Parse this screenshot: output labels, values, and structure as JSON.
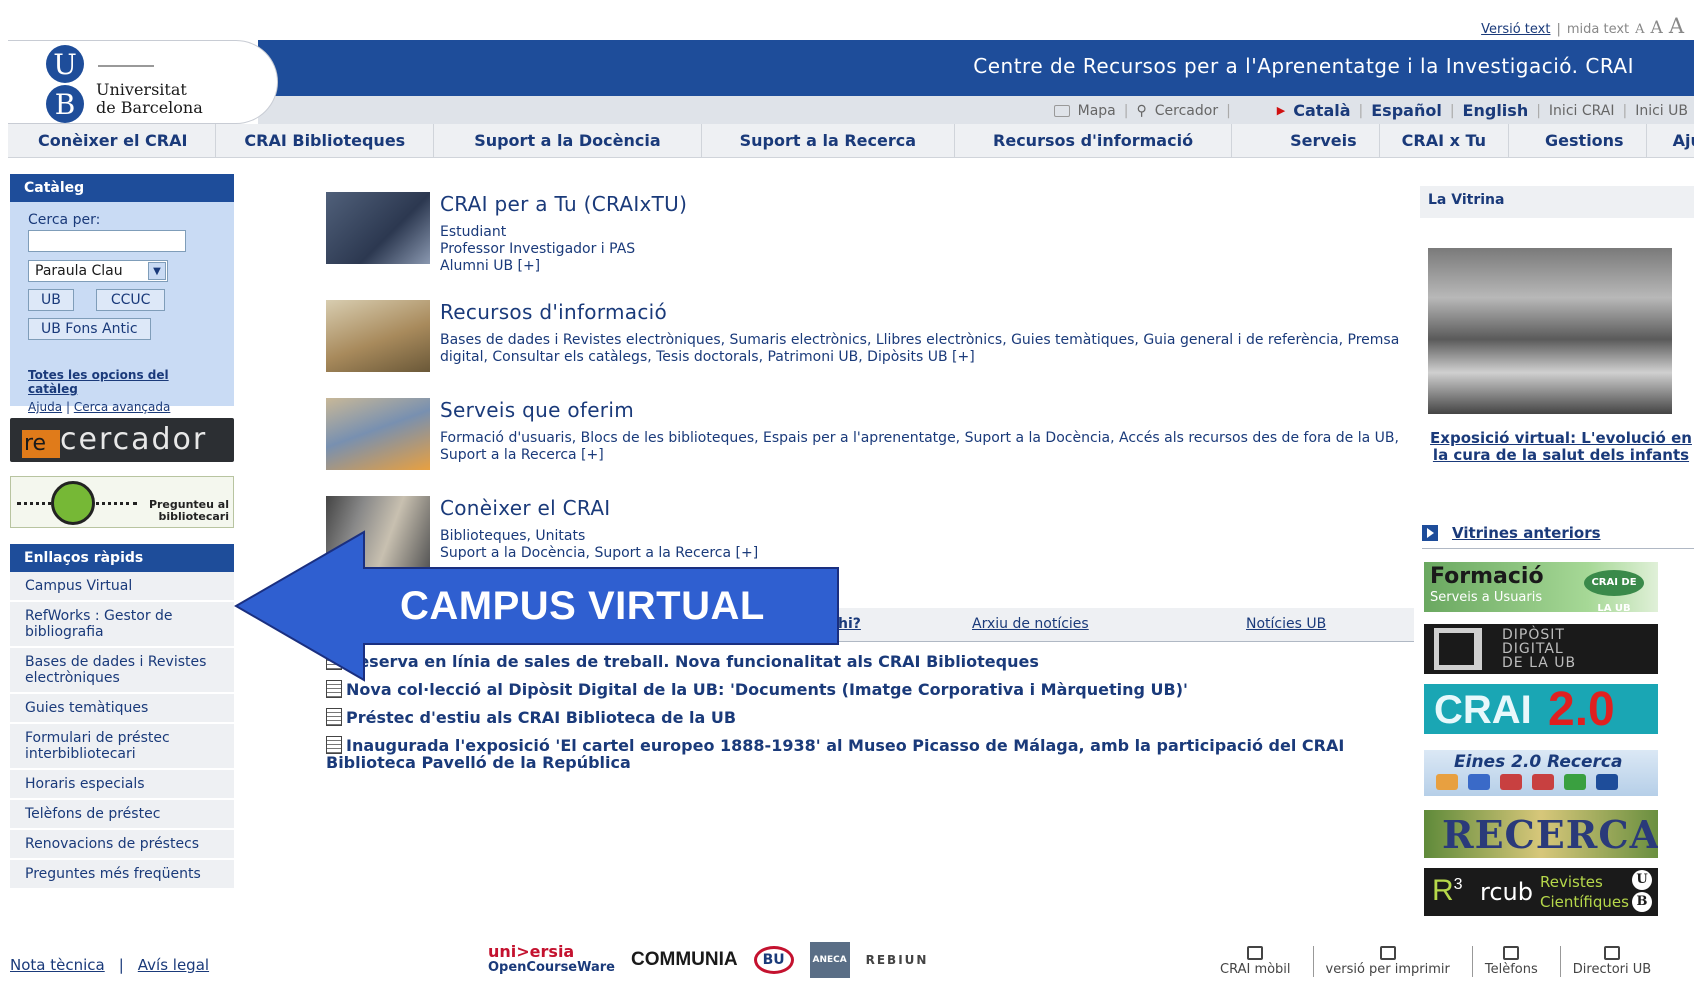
{
  "top_util": {
    "text_version": "Versió text",
    "text_size_label": "mida text",
    "sizes": [
      "A",
      "A",
      "A"
    ]
  },
  "header": {
    "logo_letters": [
      "U",
      "B"
    ],
    "logo_line1": "Universitat",
    "logo_line2": "de Barcelona",
    "title": "Centre de Recursos per a l'Aprenentatge i la Investigació. CRAI",
    "util": {
      "map": "Mapa",
      "search": "Cercador",
      "lang_ca": "Català",
      "lang_es": "Español",
      "lang_en": "English",
      "home_crai": "Inici CRAI",
      "home_ub": "Inici UB"
    }
  },
  "nav": [
    "Conèixer el CRAI",
    "CRAI Biblioteques",
    "Suport a la Docència",
    "Suport a la Recerca",
    "Recursos d'informació",
    "Serveis",
    "CRAI x Tu",
    "Gestions",
    "Ajuda"
  ],
  "catalog": {
    "title": "Catàleg",
    "search_label": "Cerca per:",
    "search_value": "",
    "select_value": "Paraula Clau",
    "btn_ub": "UB",
    "btn_ccuc": "CCUC",
    "btn_fons": "UB Fons Antic",
    "all_options": "Totes les opcions del catàleg",
    "help": "Ajuda",
    "advanced": "Cerca avançada"
  },
  "recercador": {
    "re": "re",
    "rest": "cercador"
  },
  "pregunteu": {
    "line1": "Pregunteu al",
    "line2": "bibliotecari"
  },
  "quick": {
    "title": "Enllaços ràpids",
    "items": [
      "Campus Virtual",
      "RefWorks : Gestor de bibliografia",
      "Bases de dades i Revistes electròniques",
      "Guies temàtiques",
      "Formulari de préstec interbibliotecari",
      "Horaris especials",
      "Telèfons de préstec",
      "Renovacions de préstecs",
      "Preguntes més freqüents"
    ]
  },
  "sections": [
    {
      "title": "CRAI per a Tu (CRAIxTU)",
      "lines": [
        "Estudiant",
        "Professor Investigador i PAS",
        "Alumni UB [+]"
      ]
    },
    {
      "title": "Recursos d'informació",
      "lines": [
        "Bases de dades i Revistes electròniques, Sumaris electrònics, Llibres electrònics, Guies temàtiques, Guia general i de referència, Premsa digital, Consultar els catàlegs, Tesis doctorals, Patrimoni UB, Dipòsits UB [+]"
      ]
    },
    {
      "title": "Serveis que oferim",
      "lines": [
        "Formació d'usuaris, Blocs de les biblioteques, Espais per a l'aprenentatge, Suport a la Docència, Accés als recursos des de fora de la UB, Suport a la Recerca [+]"
      ]
    },
    {
      "title": "Conèixer el CRAI",
      "lines": [
        "Biblioteques, Unitats",
        "Suport a la Docència, Suport a la Recerca [+]"
      ]
    }
  ],
  "news_tabs": {
    "what": "hi?",
    "archive": "Arxiu de notícies",
    "ub": "Notícies UB"
  },
  "news": [
    "Reserva en línia de sales de treball. Nova funcionalitat als CRAI Biblioteques",
    "Nova col·lecció al Dipòsit Digital de la UB: 'Documents (Imatge Corporativa i Màrqueting UB)'",
    "Préstec d'estiu als CRAI Biblioteca de la UB",
    "Inaugurada l'exposició 'El cartel europeo 1888-1938' al Museo Picasso de Málaga, amb la participació del CRAI Biblioteca Pavelló de la República"
  ],
  "callout": {
    "label": "CAMPUS VIRTUAL",
    "color": "#2f5fd0"
  },
  "vitrina": {
    "title": "La Vitrina",
    "caption": "Exposició virtual: L'evolució en la cura de la salut dels infants",
    "previous": "Vitrines anteriors"
  },
  "banners": {
    "formacio_title": "Formació",
    "formacio_sub": "Serveis a Usuaris",
    "formacio_badge": "CRAI DE LA UB",
    "diposit": [
      "DIPÒSIT",
      "DIGITAL",
      "DE LA UB"
    ],
    "crai": "CRAI",
    "crai_v": "2.0",
    "eines": "Eines 2.0 Recerca",
    "recercat": "RECERCAT",
    "rcub_r": "R",
    "rcub_sup": "3",
    "rcub_name": "rcub",
    "rcub_line1": "Revistes",
    "rcub_line2": "Científiques",
    "rcub_u": "U",
    "rcub_b": "B"
  },
  "footer": {
    "nota": "Nota tècnica",
    "avis": "Avís legal",
    "universia": "uni>ersia",
    "ocw": "OpenCourseWare",
    "communia": "COMMUNIA",
    "bu": "BU",
    "aneca": "ANECA",
    "rebiun": "REBIUN",
    "mobil": "CRAI mòbil",
    "print": "versió per imprimir",
    "phones": "Telèfons",
    "directory": "Directori UB"
  }
}
